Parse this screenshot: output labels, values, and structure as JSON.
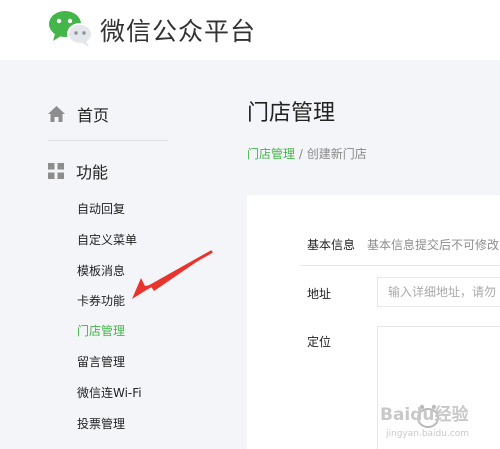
{
  "header": {
    "brand_title": "微信公众平台",
    "logo_icon": "wechat-logo-icon"
  },
  "sidebar": {
    "home_label": "首页",
    "home_icon": "home-icon",
    "features_label": "功能",
    "features_icon": "grid-icon",
    "items": [
      {
        "label": "自动回复",
        "active": false
      },
      {
        "label": "自定义菜单",
        "active": false
      },
      {
        "label": "模板消息",
        "active": false
      },
      {
        "label": "卡券功能",
        "active": false
      },
      {
        "label": "门店管理",
        "active": true
      },
      {
        "label": "留言管理",
        "active": false
      },
      {
        "label": "微信连Wi-Fi",
        "active": false
      },
      {
        "label": "投票管理",
        "active": false
      }
    ]
  },
  "main": {
    "page_title": "门店管理",
    "breadcrumb": {
      "link": "门店管理",
      "separator": "/",
      "current": "创建新门店"
    },
    "form": {
      "section_label": "基本信息",
      "section_hint": "基本信息提交后不可修改",
      "address_label": "地址",
      "address_placeholder": "输入详细地址，请勿",
      "location_label": "定位"
    }
  },
  "watermark": {
    "brand": "Baidu经验",
    "url": "jingyan.baidu.com"
  },
  "colors": {
    "accent": "#44b549",
    "background": "#f4f5f9",
    "arrow": "#e8342c"
  }
}
